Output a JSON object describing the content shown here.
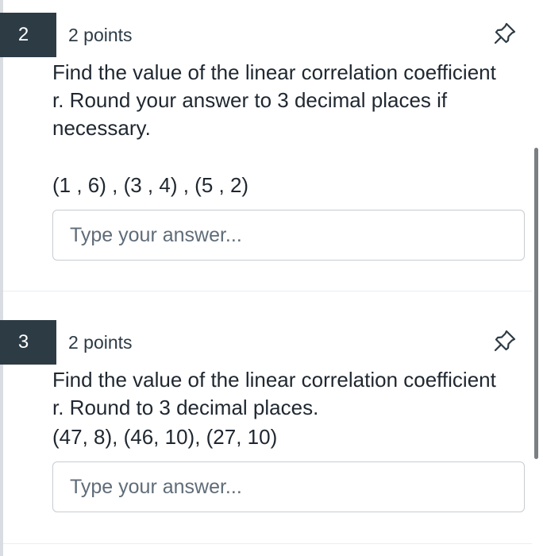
{
  "questions": [
    {
      "number": "2",
      "points": "2 points",
      "prompt": "Find the value of the linear correlation coefficient r. Round your answer to 3 decimal places if necessary.",
      "data_points": "(1 , 6) , (3 , 4) , (5 , 2)",
      "answer_placeholder": "Type your answer...",
      "pin_icon": "pin-icon"
    },
    {
      "number": "3",
      "points": "2 points",
      "prompt": "Find the value of the linear correlation coefficient r. Round to 3 decimal places.",
      "data_points": "(47, 8), (46, 10), (27, 10)",
      "answer_placeholder": "Type your answer...",
      "pin_icon": "pin-icon"
    }
  ],
  "colors": {
    "number_badge": "#2d3b45",
    "text": "#1f2730",
    "input_border": "#c7cdd1",
    "placeholder": "#5f6c78"
  }
}
